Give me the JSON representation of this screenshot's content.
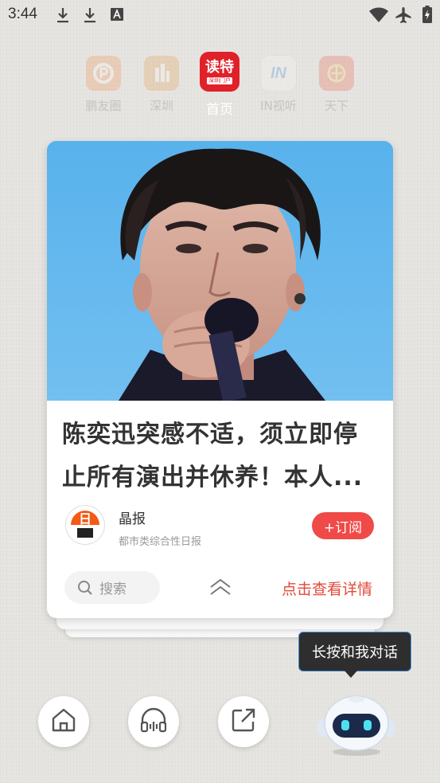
{
  "status_bar": {
    "time": "3:44",
    "icons": [
      "download-icon",
      "download-icon",
      "a-badge-icon",
      "wifi-icon",
      "airplane-icon",
      "battery-charging-icon"
    ]
  },
  "channels": [
    {
      "label": "鹏友圈",
      "icon": "pengyouquan-icon",
      "state": "faded"
    },
    {
      "label": "深圳",
      "icon": "shenzhen-icon",
      "state": "faded"
    },
    {
      "label": "首页",
      "icon": "duote-logo-icon",
      "state": "active",
      "logo_title": "读特",
      "logo_sub": "深圳门户"
    },
    {
      "label": "IN视听",
      "icon": "in-media-icon",
      "state": "faded",
      "icon_text": "IN"
    },
    {
      "label": "天下",
      "icon": "tianxia-icon",
      "state": "faded"
    }
  ],
  "card": {
    "headline_line1": "陈奕迅突感不适，须立即停",
    "headline_line2": "止所有演出并休养！本人...",
    "source": {
      "name": "晶报",
      "description": "都市类综合性日报",
      "avatar_text": "日"
    },
    "subscribe_label": "+订阅",
    "search_placeholder": "搜索",
    "detail_label": "点击查看详情"
  },
  "tooltip": "长按和我对话",
  "bottom_nav": [
    "home-icon",
    "headphones-icon",
    "share-icon",
    "robot-assistant-icon"
  ],
  "colors": {
    "accent_red": "#f04a48",
    "brand_red": "#e0212a",
    "detail_red": "#e04a3a"
  }
}
